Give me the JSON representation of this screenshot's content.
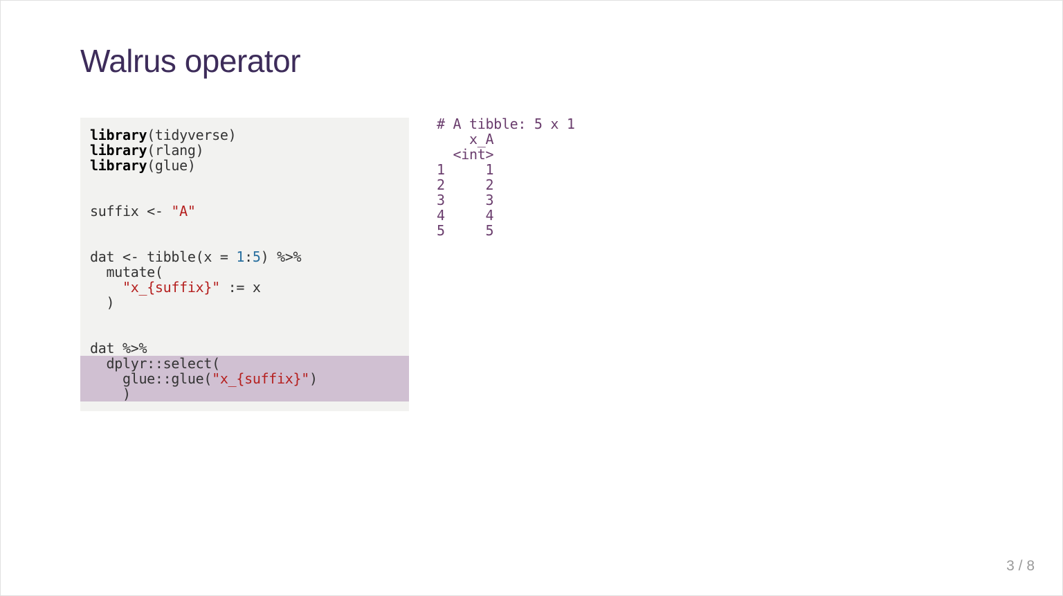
{
  "slide": {
    "title": "Walrus operator",
    "page_current": "3",
    "page_sep": " / ",
    "page_total": "8"
  },
  "code": {
    "lib_kw": "library",
    "lib1_arg": "(tidyverse)",
    "lib2_arg": "(rlang)",
    "lib3_arg": "(glue)",
    "suffix_lhs": "suffix <- ",
    "suffix_str": "\"A\"",
    "dat_assign": "dat <- tibble(x = ",
    "one": "1",
    "colon": ":",
    "five": "5",
    "dat_tail": ") %>%",
    "mutate_open": "  mutate(",
    "mutate_str": "\"x_{suffix}\"",
    "mutate_tail": " := x",
    "indent4": "    ",
    "close_paren": "  )",
    "dat_pipe": "dat %>%",
    "select_line": "  dplyr::select(",
    "glue_prefix": "    glue::glue(",
    "glue_str": "\"x_{suffix}\"",
    "glue_suffix": ")",
    "close_paren2": "    )"
  },
  "output": {
    "header": "# A tibble: 5 x 1",
    "colname_line": "    x_A",
    "type_line": "  <int>",
    "r1": "1     1",
    "r2": "2     2",
    "r3": "3     3",
    "r4": "4     4",
    "r5": "5     5"
  }
}
